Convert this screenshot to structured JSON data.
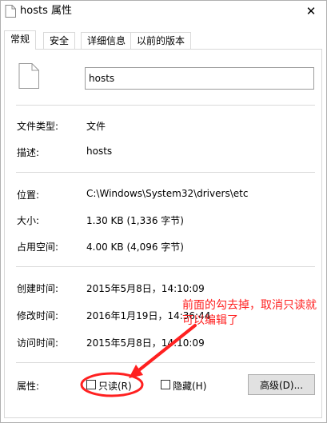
{
  "window": {
    "title": "hosts 属性",
    "close_glyph": "✕"
  },
  "tabs": [
    {
      "label": "常规",
      "active": true
    },
    {
      "label": "安全",
      "active": false
    },
    {
      "label": "详细信息",
      "active": false
    },
    {
      "label": "以前的版本",
      "active": false
    }
  ],
  "general": {
    "filename": "hosts",
    "type_label": "文件类型:",
    "type_value": "文件",
    "desc_label": "描述:",
    "desc_value": "hosts",
    "location_label": "位置:",
    "location_value": "C:\\Windows\\System32\\drivers\\etc",
    "size_label": "大小:",
    "size_value": "1.30 KB (1,336 字节)",
    "disk_label": "占用空间:",
    "disk_value": "4.00 KB (4,096 字节)",
    "created_label": "创建时间:",
    "created_value": "2015年5月8日，14:10:09",
    "modified_label": "修改时间:",
    "modified_value": "2016年1月19日，14:36:44",
    "accessed_label": "访问时间:",
    "accessed_value": "2015年5月8日，14:10:09",
    "attributes_label": "属性:",
    "readonly_label": "只读(R)",
    "readonly_checked": false,
    "hidden_label": "隐藏(H)",
    "hidden_checked": false,
    "advanced_label": "高级(D)..."
  },
  "annotation": {
    "text": "前面的勾去掉，取消只读就可以编辑了",
    "color": "#ff2020"
  }
}
